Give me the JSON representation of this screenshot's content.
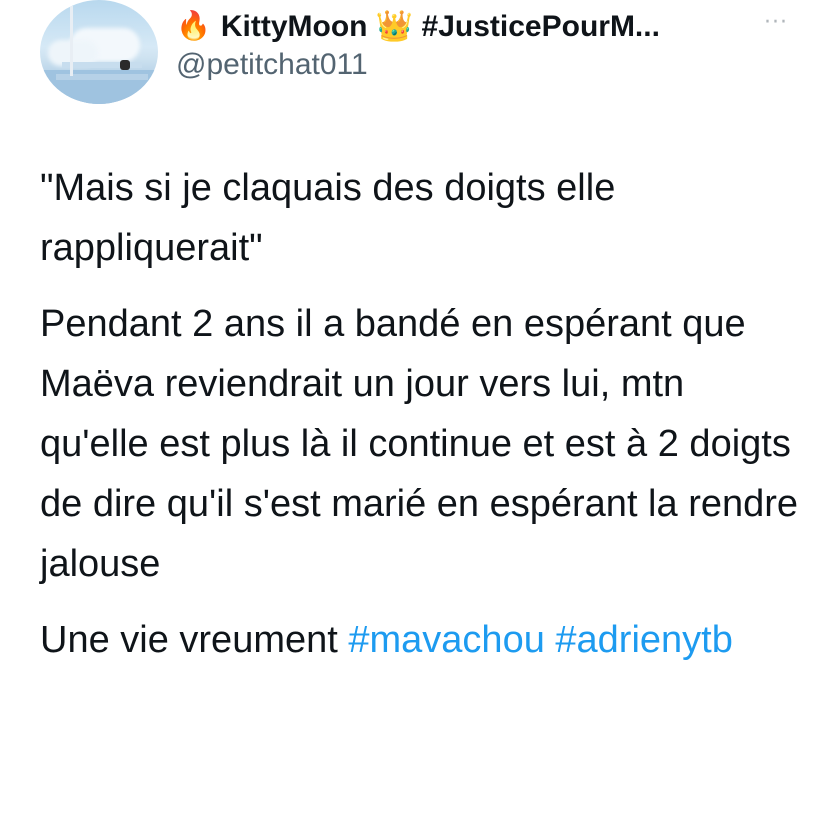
{
  "author": {
    "display_name_prefix_emoji": "🔥",
    "display_name": "KittyMoon 👑 #JusticePourM...",
    "handle": "@petitchat011"
  },
  "tweet": {
    "quote": "\"Mais si je claquais des doigts elle rappliquerait\"",
    "paragraph": "Pendant 2 ans il a bandé en espérant que Maëva reviendrait un jour vers lui, mtn qu'elle est plus là il continue et est à 2 doigts de dire qu'il s'est marié en espérant la rendre jalouse",
    "closing_text": "Une vie vreument ",
    "hashtags": [
      "#mavachou",
      "#adrienytb"
    ]
  },
  "colors": {
    "hashtag": "#1d9bf0",
    "text": "#0f1419",
    "handle": "#536471"
  },
  "icons": {
    "more": "more-horizontal-icon"
  }
}
